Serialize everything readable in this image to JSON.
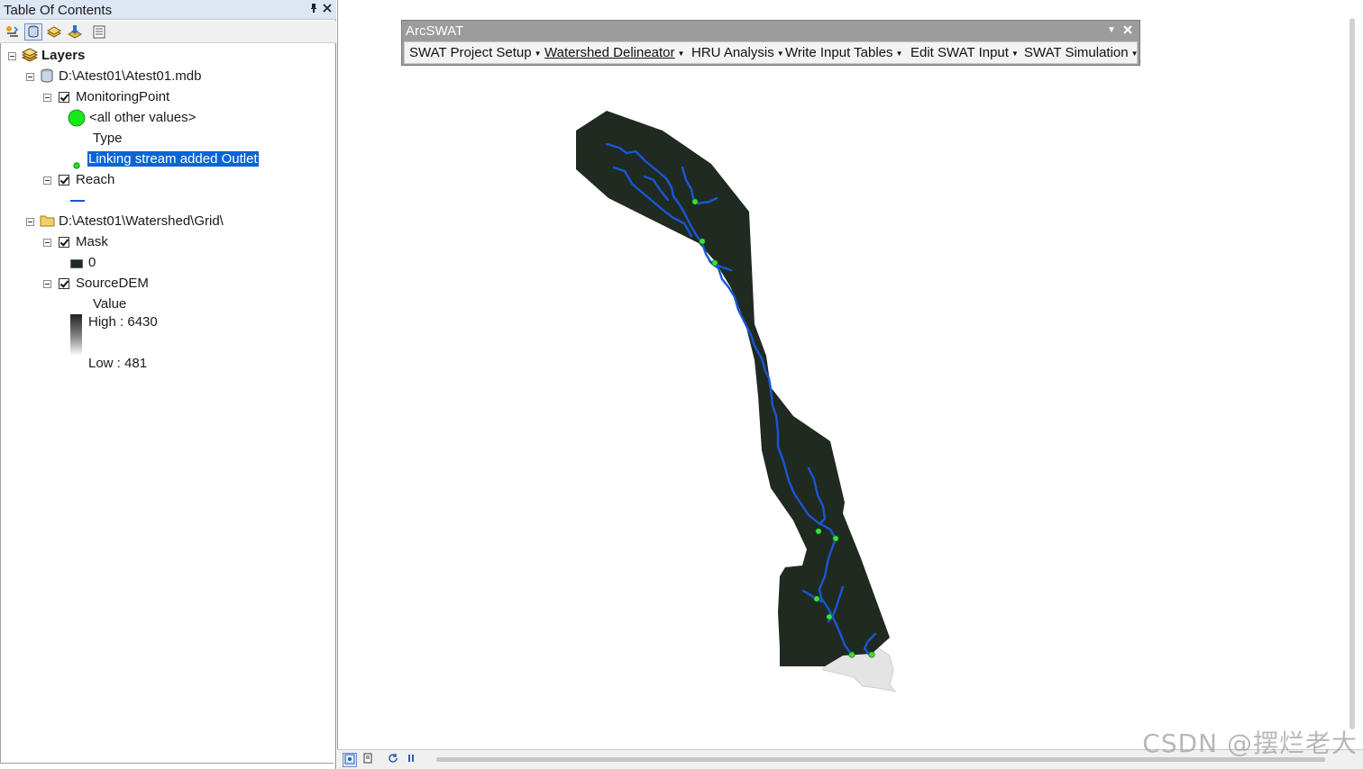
{
  "toc": {
    "title": "Table Of Contents",
    "pin_icon": "pin-icon",
    "close_icon": "close-icon",
    "tree": {
      "root_label": "Layers",
      "db_label": "D:\\Atest01\\Atest01.mdb",
      "monitoring_label": "MonitoringPoint",
      "all_other_values": "<all other values>",
      "type_heading": "Type",
      "outlet_label": "Linking stream added Outlet",
      "reach_label": "Reach",
      "grid_label": "D:\\Atest01\\Watershed\\Grid\\",
      "mask_label": "Mask",
      "mask_value": "0",
      "dem_label": "SourceDEM",
      "value_heading": "Value",
      "high_label": "High : 6430",
      "low_label": "Low : 481"
    }
  },
  "arcswat": {
    "title": "ArcSWAT",
    "menus": [
      "SWAT Project Setup",
      "Watershed Delineator",
      "HRU Analysis",
      "Write Input Tables",
      "Edit SWAT Input",
      "SWAT Simulation"
    ]
  },
  "watermark": "CSDN @摆烂老大",
  "colors": {
    "watershed": "#1f2a21",
    "stream": "#1a56d6",
    "point": "#3ce03c",
    "selection": "#0a64d6"
  }
}
